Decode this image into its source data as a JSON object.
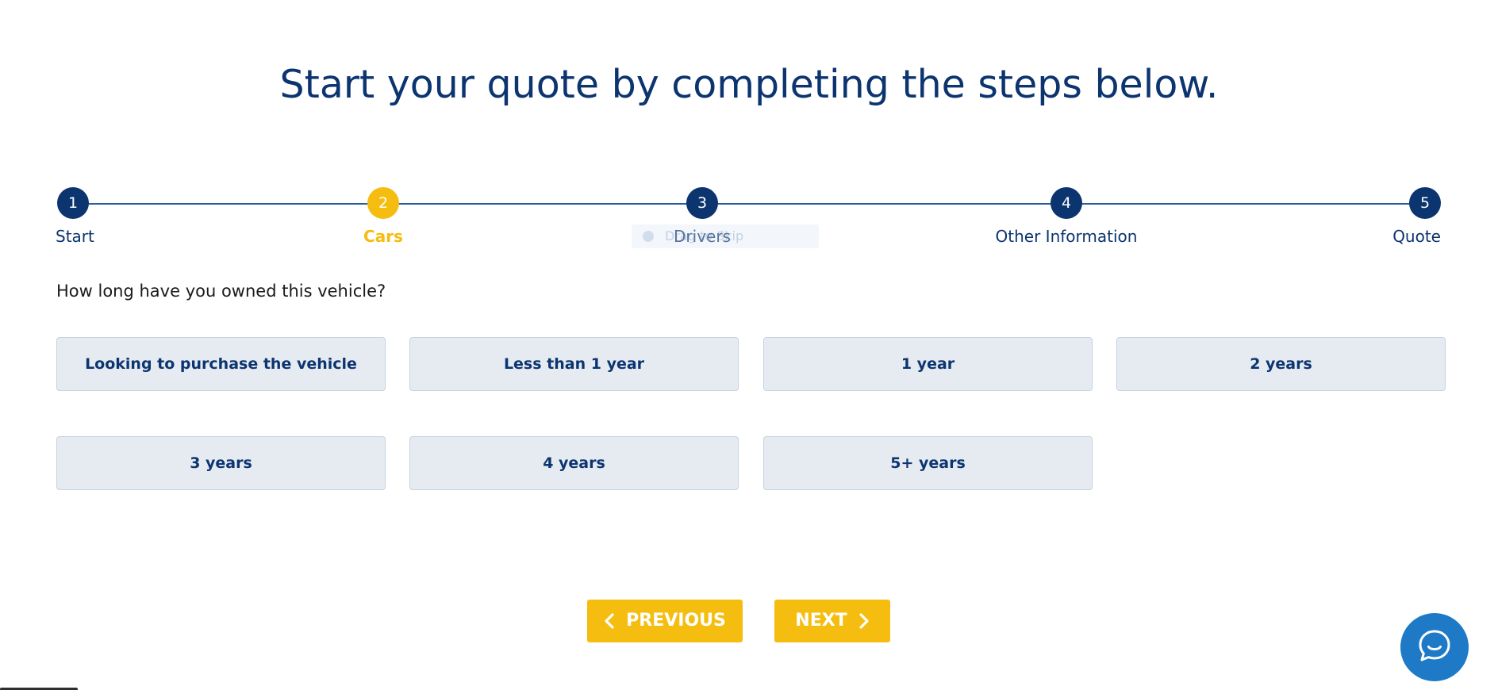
{
  "heading": "Start your quote by completing the steps below.",
  "steps": [
    {
      "number": "1",
      "label": "Start",
      "state": "done"
    },
    {
      "number": "2",
      "label": "Cars",
      "state": "active"
    },
    {
      "number": "3",
      "label": "Drivers",
      "state": "pending"
    },
    {
      "number": "4",
      "label": "Other Information",
      "state": "pending"
    },
    {
      "number": "5",
      "label": "Quote",
      "state": "pending"
    }
  ],
  "overlay": {
    "text": "Drag to Skip"
  },
  "question": "How long have you owned this vehicle?",
  "options": [
    "Looking to purchase the vehicle",
    "Less than 1 year",
    "1 year",
    "2 years",
    "3 years",
    "4 years",
    "5+ years"
  ],
  "nav": {
    "previous": "PREVIOUS",
    "next": "NEXT"
  },
  "icons": {
    "previous": "chevron-left-icon",
    "next": "chevron-right-icon",
    "chat": "chat-bubble-icon"
  },
  "colors": {
    "primary": "#0c3570",
    "accent": "#f4bd10",
    "option_bg": "#e6ebf2",
    "chat": "#1e7ac7"
  }
}
